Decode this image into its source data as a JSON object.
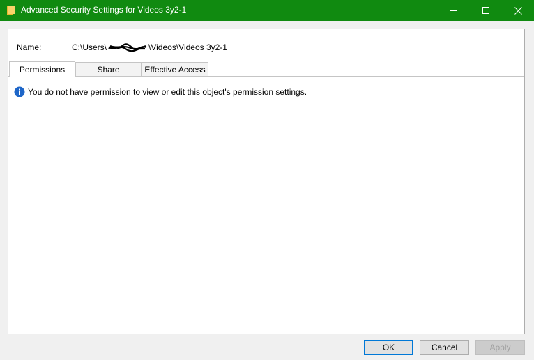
{
  "window": {
    "title": "Advanced Security Settings for Videos 3y2-1",
    "titlebar_color": "#108a10"
  },
  "name_field": {
    "label": "Name:",
    "path_prefix": "C:\\Users\\",
    "path_suffix": "\\Videos\\Videos 3y2-1"
  },
  "tabs": [
    {
      "label": "Permissions",
      "selected": true
    },
    {
      "label": "Share",
      "selected": false
    },
    {
      "label": "Effective Access",
      "selected": false
    }
  ],
  "message": "You do not have permission to view or edit this object's permission settings.",
  "buttons": {
    "ok": "OK",
    "cancel": "Cancel",
    "apply": "Apply"
  },
  "icons": {
    "window": "folder-icon",
    "info": "info-icon",
    "accent": "#0078d7"
  }
}
